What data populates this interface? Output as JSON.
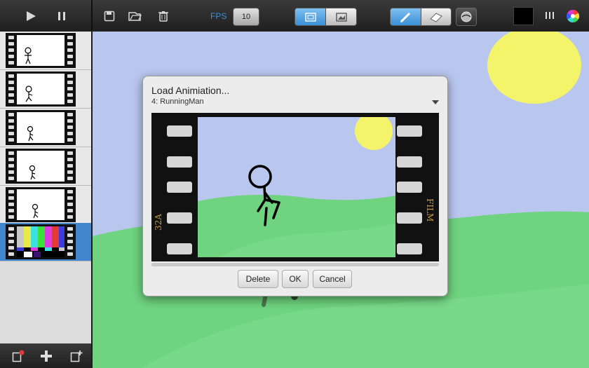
{
  "toolbar": {
    "fps_label": "FPS",
    "fps_value": "10"
  },
  "icons": {
    "play": "play-icon",
    "pause": "pause-icon",
    "save": "save-icon",
    "open": "open-icon",
    "trash": "trash-icon",
    "onion_skin": "onion-skin-icon",
    "background": "background-icon",
    "pencil": "pencil-icon",
    "eraser": "eraser-icon",
    "fill": "fill-icon",
    "brush_size": "brush-size-icon",
    "color_wheel": "color-wheel-icon",
    "delete_frame": "delete-frame-icon",
    "add_frame": "add-frame-icon",
    "duplicate_frame": "duplicate-frame-icon"
  },
  "colors": {
    "current_color": "#000000",
    "sky": "#b9c6ee",
    "sun": "#f4f46a",
    "grass": "#6fd37f",
    "accent_blue": "#3f86cf"
  },
  "dialog": {
    "title": "Load Animiation...",
    "selected": "4: RunningMan",
    "film_left": "32A",
    "film_right": "FILM",
    "buttons": {
      "delete": "Delete",
      "ok": "OK",
      "cancel": "Cancel"
    }
  },
  "frames": [
    {
      "index": 1,
      "selected": false
    },
    {
      "index": 2,
      "selected": false
    },
    {
      "index": 3,
      "selected": false
    },
    {
      "index": 4,
      "selected": false
    },
    {
      "index": 5,
      "selected": false
    },
    {
      "index": 6,
      "selected": true
    }
  ]
}
